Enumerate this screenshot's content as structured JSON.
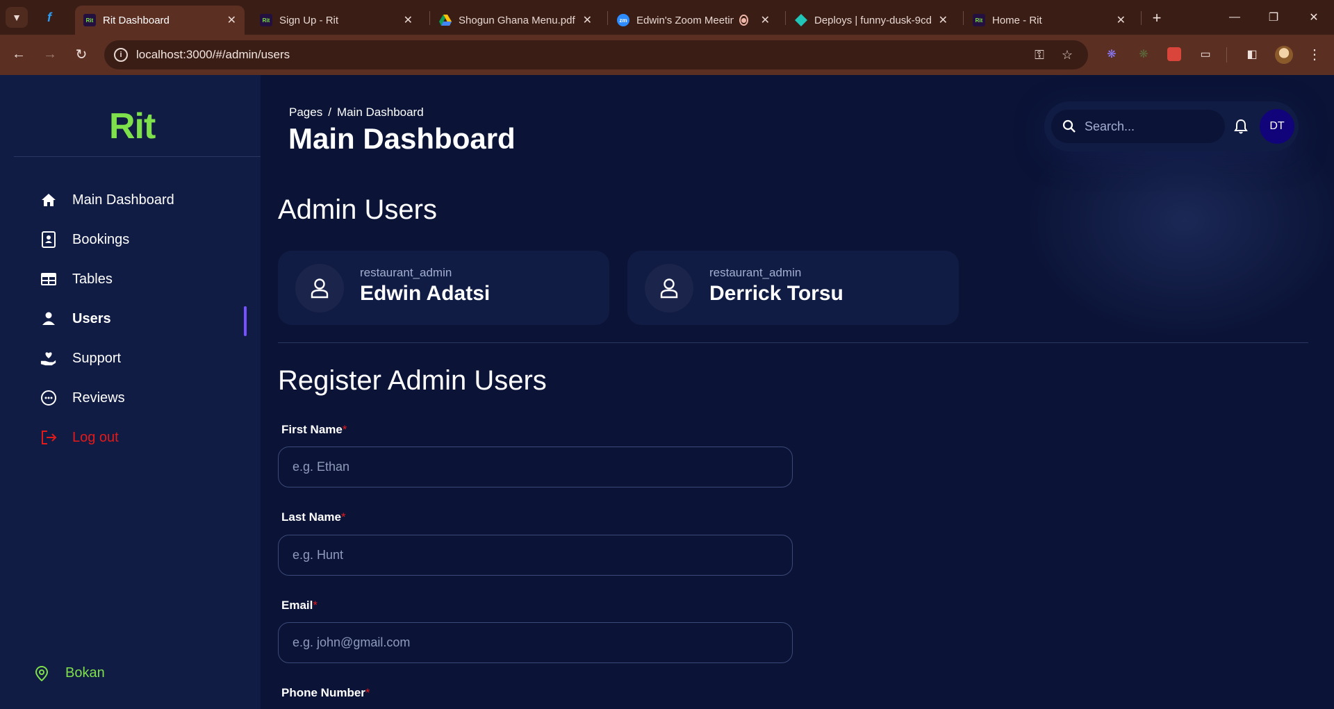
{
  "browser": {
    "tabs": [
      {
        "title": "Rit Dashboard",
        "favicon": "rit-favicon",
        "active": true
      },
      {
        "title": "Sign Up - Rit",
        "favicon": "rit-favicon",
        "active": false
      },
      {
        "title": "Shogun Ghana Menu.pdf",
        "favicon": "google-drive-favicon",
        "active": false
      },
      {
        "title": "Edwin's Zoom Meeting",
        "favicon": "zoom-favicon",
        "active": false
      },
      {
        "title": "Deploys | funny-dusk-9cd",
        "favicon": "netlify-favicon",
        "active": false
      },
      {
        "title": "Home - Rit",
        "favicon": "rit-favicon",
        "active": false
      }
    ],
    "url": "localhost:3000/#/admin/users",
    "rit_favicon_text": "Rit",
    "zoom_favicon_text": "zm",
    "colors": {
      "frame": "#3a1d15",
      "toolbar": "#5c2f23"
    }
  },
  "sidebar": {
    "logo": "Rit",
    "items": [
      {
        "label": "Main Dashboard",
        "icon": "home-icon"
      },
      {
        "label": "Bookings",
        "icon": "contact-book-icon"
      },
      {
        "label": "Tables",
        "icon": "table-icon"
      },
      {
        "label": "Users",
        "icon": "person-icon",
        "active": true
      },
      {
        "label": "Support",
        "icon": "heart-hand-icon"
      },
      {
        "label": "Reviews",
        "icon": "chat-bubble-icon"
      }
    ],
    "logout_label": "Log out",
    "location": "Bokan"
  },
  "header": {
    "breadcrumb_root": "Pages",
    "breadcrumb_sep": "/",
    "breadcrumb_current": "Main Dashboard",
    "title": "Main Dashboard",
    "search_placeholder": "Search...",
    "avatar_initials": "DT"
  },
  "admin_users": {
    "title": "Admin Users",
    "users": [
      {
        "role": "restaurant_admin",
        "name": "Edwin Adatsi"
      },
      {
        "role": "restaurant_admin",
        "name": "Derrick Torsu"
      }
    ]
  },
  "register": {
    "title": "Register Admin Users",
    "required_mark": "*",
    "fields": [
      {
        "label": "First Name",
        "placeholder": "e.g. Ethan"
      },
      {
        "label": "Last Name",
        "placeholder": "e.g. Hunt"
      },
      {
        "label": "Email",
        "placeholder": "e.g. john@gmail.com"
      },
      {
        "label": "Phone Number",
        "placeholder": ""
      }
    ]
  },
  "colors": {
    "accent_green": "#7ee04b",
    "accent_purple": "#7551ff",
    "danger": "#e31a1a",
    "navy_bg": "#0b1437",
    "card_bg": "#111c44"
  }
}
